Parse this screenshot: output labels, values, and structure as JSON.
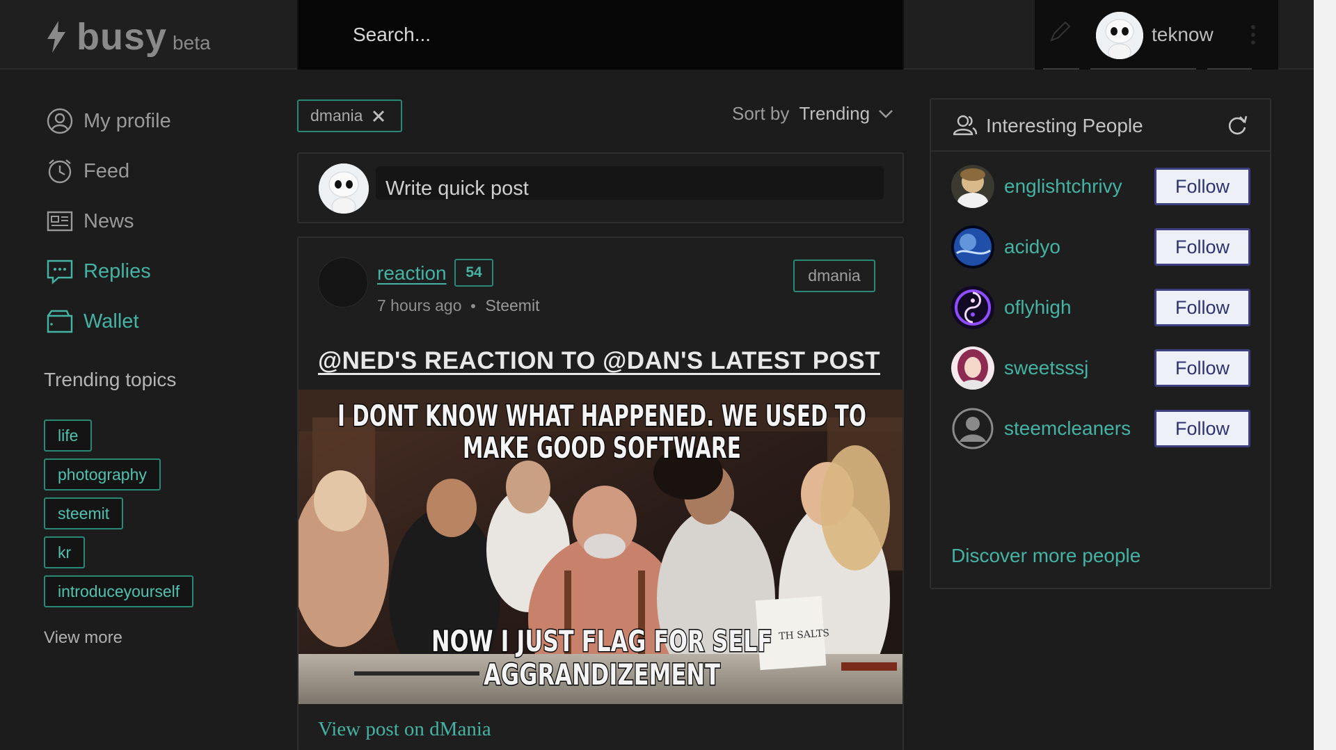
{
  "header": {
    "logo_text": "busy",
    "logo_badge": "beta",
    "search_placeholder": "Search...",
    "username": "teknow"
  },
  "sidebar": {
    "items": [
      {
        "label": "My profile",
        "icon": "user-circle-icon"
      },
      {
        "label": "Feed",
        "icon": "clock-icon"
      },
      {
        "label": "News",
        "icon": "newspaper-icon"
      },
      {
        "label": "Replies",
        "icon": "chat-icon"
      },
      {
        "label": "Wallet",
        "icon": "wallet-icon"
      }
    ],
    "trending_title": "Trending topics",
    "topics": [
      "life",
      "photography",
      "steemit",
      "kr",
      "introduceyourself"
    ],
    "view_more": "View more"
  },
  "feed": {
    "filter_tag": "dmania",
    "sort_label": "Sort by",
    "sort_value": "Trending",
    "quick_post_placeholder": "Write quick post",
    "post": {
      "author": "reaction",
      "reputation": "54",
      "time": "7 hours ago",
      "app": "Steemit",
      "tag": "dmania",
      "title": "@NED'S REACTION TO @DAN'S LATEST POST",
      "meme_top": "I DONT KNOW WHAT HAPPENED. WE USED TO MAKE GOOD SOFTWARE",
      "meme_bottom": "NOW I JUST FLAG FOR SELF AGGRANDIZEMENT",
      "meme_prop_label": "TH SALTS",
      "view_link": "View post on dMania"
    }
  },
  "people": {
    "title": "Interesting People",
    "follow_label": "Follow",
    "list": [
      {
        "name": "englishtchrivy"
      },
      {
        "name": "acidyo"
      },
      {
        "name": "oflyhigh"
      },
      {
        "name": "sweetsssj"
      },
      {
        "name": "steemcleaners"
      }
    ],
    "discover": "Discover more people"
  },
  "colors": {
    "accent": "#45b3a3",
    "background": "#1c1c1c",
    "follow_border": "#3d3f80"
  }
}
